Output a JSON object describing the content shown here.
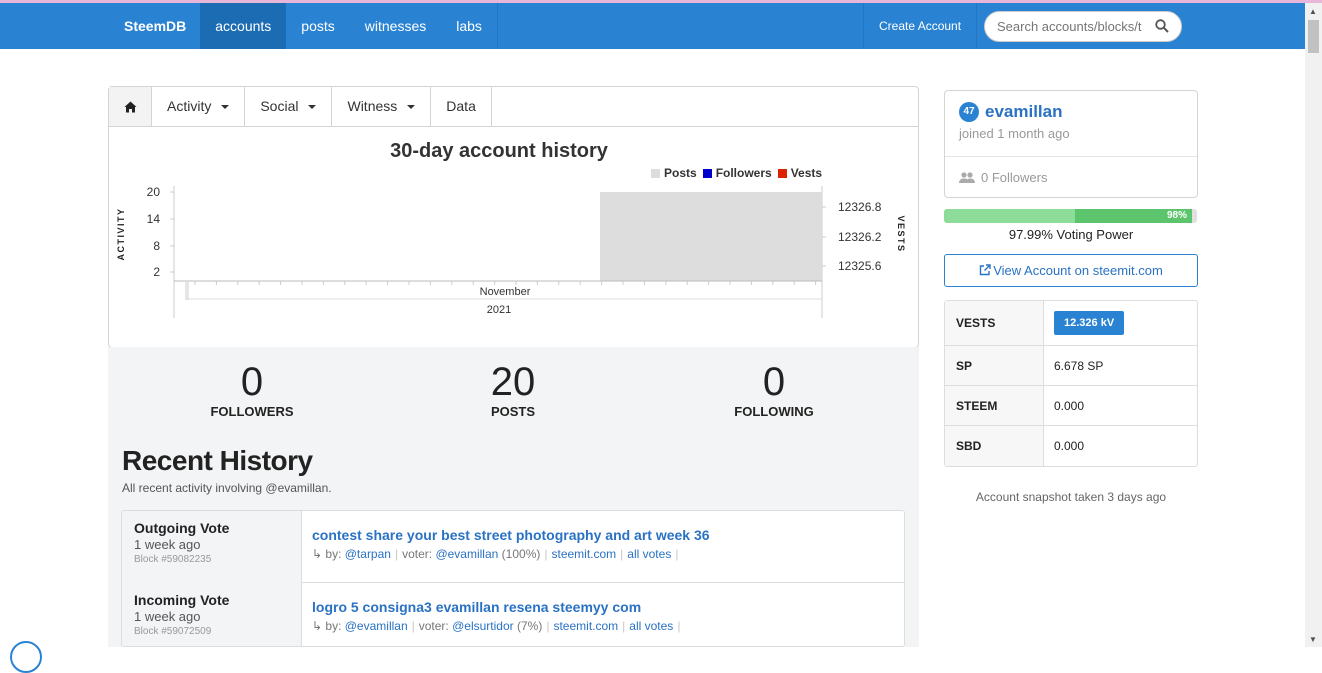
{
  "navbar": {
    "brand": "SteemDB",
    "items": [
      {
        "label": "accounts",
        "active": true
      },
      {
        "label": "posts"
      },
      {
        "label": "witnesses"
      },
      {
        "label": "labs"
      }
    ],
    "create_account": "Create Account",
    "search_placeholder": "Search accounts/blocks/t",
    "color": "#2a83d2"
  },
  "tabs": {
    "home_icon": "home-icon",
    "items": [
      "Activity",
      "Social",
      "Witness",
      "Data"
    ]
  },
  "chart_data": {
    "type": "bar",
    "title": "30-day account history",
    "legend": [
      "Posts",
      "Followers",
      "Vests"
    ],
    "legend_colors": [
      "#dddddd",
      "#0000cc",
      "#dd2200"
    ],
    "left_axis_label": "ACTIVITY",
    "right_axis_label": "VESTS",
    "left_ticks": [
      "20",
      "14",
      "8",
      "2"
    ],
    "right_ticks": [
      "12326.8",
      "12326.2",
      "12325.6"
    ],
    "x_label_month": "November",
    "x_label_year": "2021",
    "series": [
      {
        "name": "Posts",
        "values": [
          20
        ]
      }
    ],
    "legend_placement": "top-right"
  },
  "stats": {
    "followers": {
      "value": "0",
      "label": "FOLLOWERS"
    },
    "posts": {
      "value": "20",
      "label": "POSTS"
    },
    "following": {
      "value": "0",
      "label": "FOLLOWING"
    }
  },
  "recent_history": {
    "title": "Recent History",
    "subtitle": "All recent activity involving @evamillan.",
    "rows": [
      {
        "type": "Outgoing Vote",
        "time": "1 week ago",
        "block": "Block #59082235",
        "title": "contest share your best street photography and art week 36",
        "by_prefix": "↳ by:",
        "by": "@tarpan",
        "voter_prefix": "voter:",
        "voter": "@evamillan",
        "pct": "(100%)",
        "link1": "steemit.com",
        "link2": "all votes"
      },
      {
        "type": "Incoming Vote",
        "time": "1 week ago",
        "block": "Block #59072509",
        "title": "logro 5 consigna3 evamillan resena steemyy com",
        "by_prefix": "↳ by:",
        "by": "@evamillan",
        "voter_prefix": "voter:",
        "voter": "@elsurtidor",
        "pct": "(7%)",
        "link1": "steemit.com",
        "link2": "all votes"
      }
    ]
  },
  "account": {
    "reputation": "47",
    "name": "evamillan",
    "joined": "joined 1 month ago",
    "followers": "0 Followers"
  },
  "voting_power": {
    "bar_fraction": 0.98,
    "bar_label": "98%",
    "label": "97.99% Voting Power"
  },
  "view_button": "View Account on steemit.com",
  "balances": [
    {
      "key": "VESTS",
      "value": "12.326 kV"
    },
    {
      "key": "SP",
      "value": "6.678 SP"
    },
    {
      "key": "STEEM",
      "value": "0.000"
    },
    {
      "key": "SBD",
      "value": "0.000"
    }
  ],
  "snapshot": "Account snapshot taken 3 days ago"
}
